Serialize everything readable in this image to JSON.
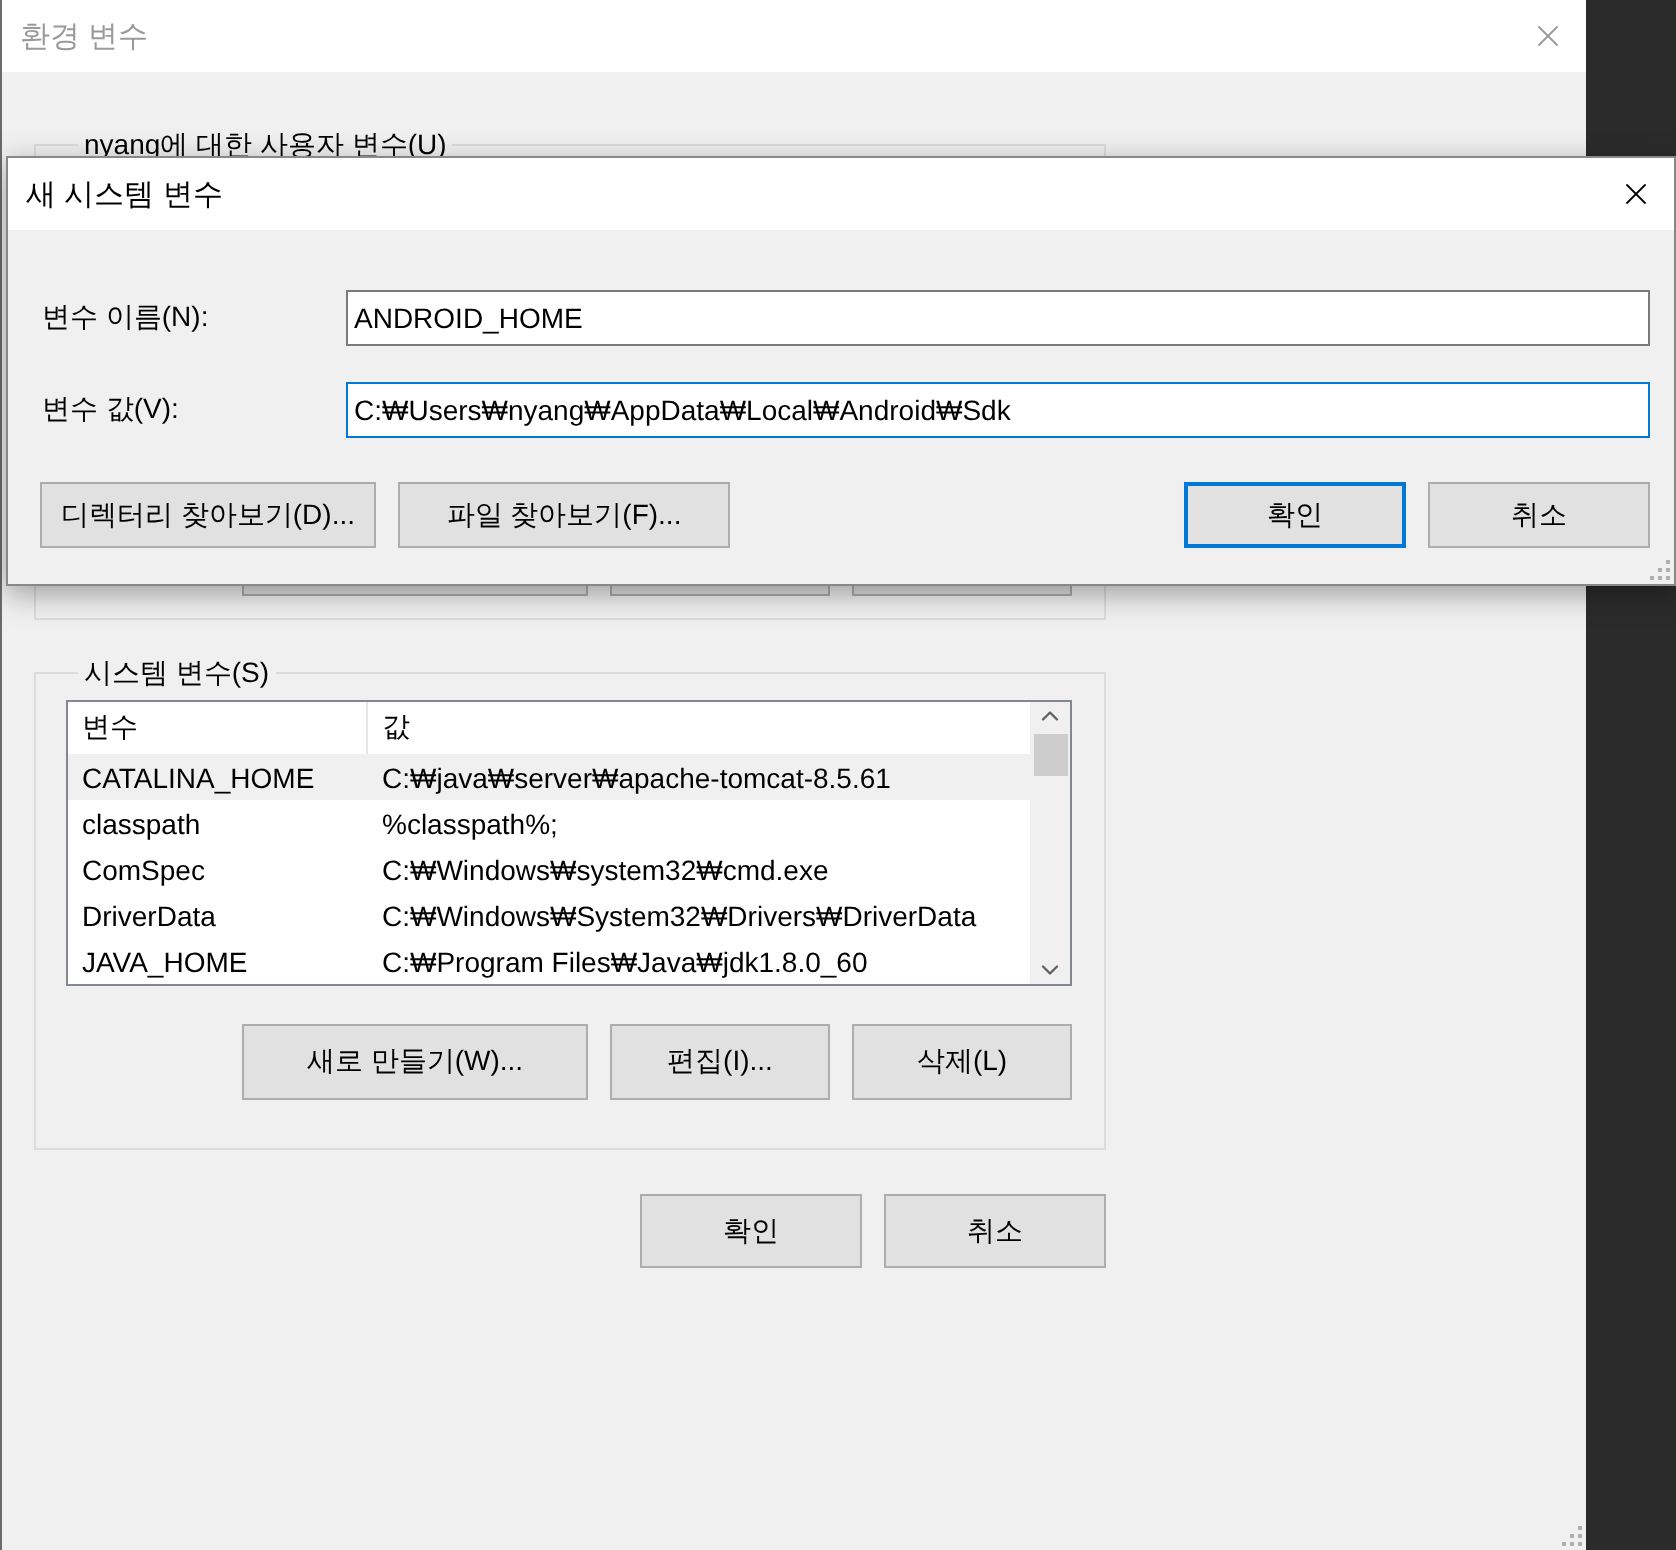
{
  "main_window": {
    "title": "환경 변수",
    "active": false,
    "user_section": {
      "label": "nyang에 대한 사용자 변수(U)"
    },
    "system_section": {
      "label": "시스템 변수(S)",
      "columns": [
        "변수",
        "값"
      ],
      "rows": [
        {
          "name": "CATALINA_HOME",
          "value": "C:₩java₩server₩apache-tomcat-8.5.61",
          "selected": true
        },
        {
          "name": "classpath",
          "value": "%classpath%;",
          "selected": false
        },
        {
          "name": "ComSpec",
          "value": "C:₩Windows₩system32₩cmd.exe",
          "selected": false
        },
        {
          "name": "DriverData",
          "value": "C:₩Windows₩System32₩Drivers₩DriverData",
          "selected": false
        },
        {
          "name": "JAVA_HOME",
          "value": "C:₩Program Files₩Java₩jdk1.8.0_60",
          "selected": false
        }
      ],
      "buttons": [
        "새로 만들기(W)...",
        "편집(I)...",
        "삭제(L)"
      ]
    },
    "buttons": [
      "확인",
      "취소"
    ]
  },
  "dialog": {
    "title": "새 시스템 변수",
    "fields": [
      {
        "label": "변수 이름(N):",
        "value": "ANDROID_HOME",
        "focused": false
      },
      {
        "label": "변수 값(V):",
        "value": "C:₩Users₩nyang₩AppData₩Local₩Android₩Sdk",
        "focused": true
      }
    ],
    "browse_buttons": [
      "디렉터리 찾아보기(D)...",
      "파일 찾아보기(F)..."
    ],
    "buttons": [
      {
        "label": "확인",
        "default": true
      },
      {
        "label": "취소",
        "default": false
      }
    ]
  }
}
